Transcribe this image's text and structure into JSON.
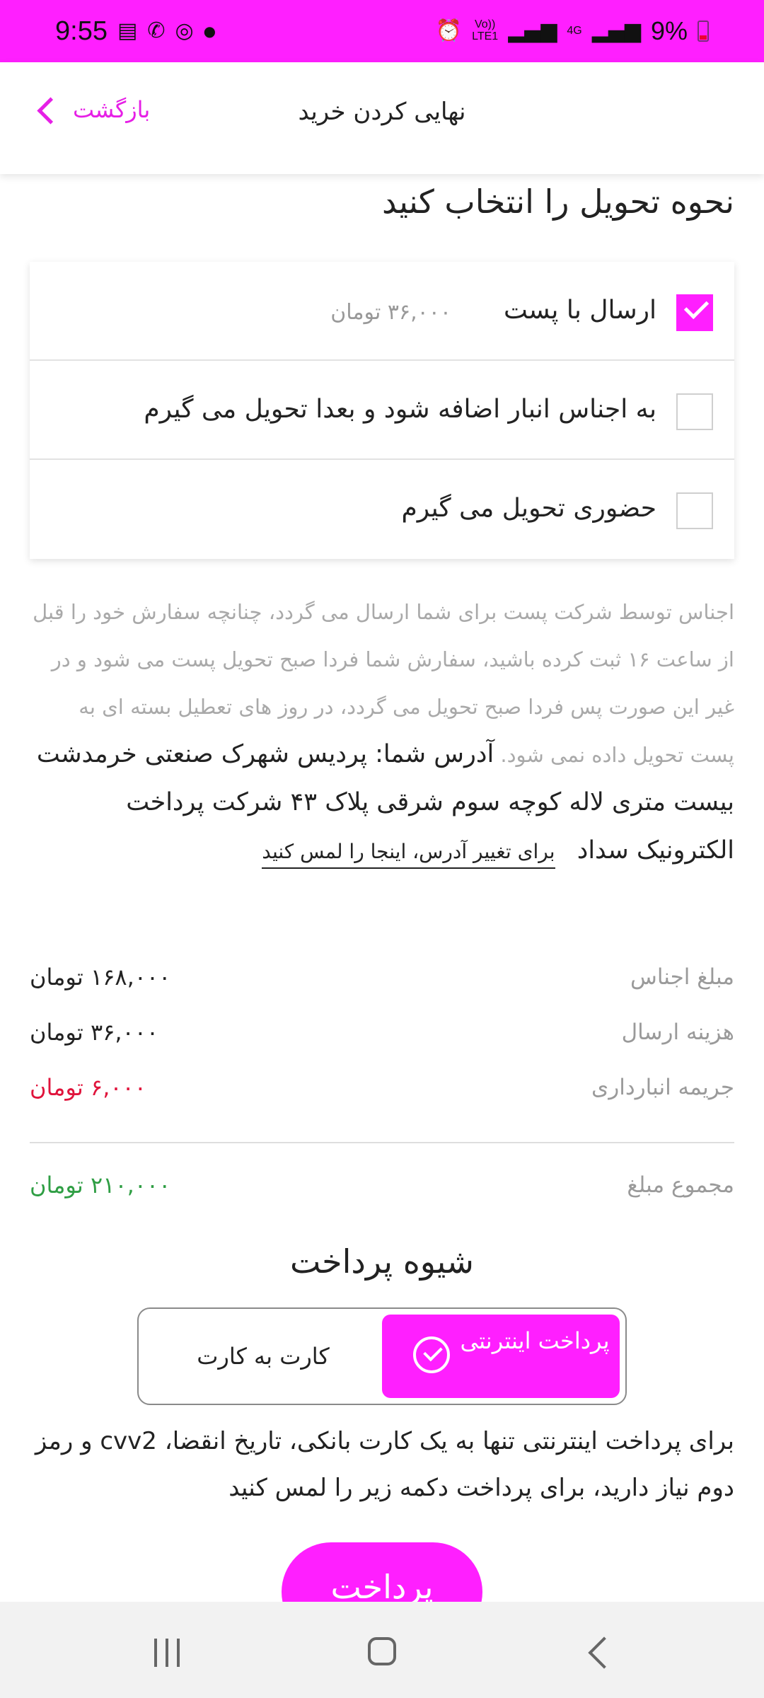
{
  "status_bar": {
    "time": "9:55",
    "battery": "9%",
    "volte": "Vo))\nLTE1",
    "network": "4G"
  },
  "header": {
    "title": "نهایی کردن خرید",
    "back_label": "بازگشت"
  },
  "delivery": {
    "title": "نحوه تحویل را انتخاب کنید",
    "options": [
      {
        "label": "ارسال با پست",
        "price": "۳۶,۰۰۰ تومان",
        "checked": true
      },
      {
        "label": "به اجناس انبار اضافه شود و بعدا تحویل می گیرم",
        "checked": false
      },
      {
        "label": "حضوری تحویل می گیرم",
        "checked": false
      }
    ]
  },
  "info": {
    "text": "اجناس توسط شرکت پست برای شما ارسال می گردد، چنانچه سفارش خود را قبل از ساعت ۱۶ ثبت کرده باشید، سفارش شما فردا صبح تحویل پست می شود و در غیر این صورت پس فردا صبح تحویل می گردد، در روز های تعطیل بسته ای به پست تحویل داده نمی شود.",
    "address": "آدرس شما: پردیس شهرک صنعتی خرمدشت بیست متری لاله کوچه سوم شرقی پلاک ۴۳ شرکت پرداخت الکترونیک سداد",
    "change_link": "برای تغییر آدرس، اینجا را لمس کنید"
  },
  "summary": {
    "items_label": "مبلغ اجناس",
    "items_value": "۱۶۸,۰۰۰ تومان",
    "shipping_label": "هزینه ارسال",
    "shipping_value": "۳۶,۰۰۰ تومان",
    "penalty_label": "جریمه انبارداری",
    "penalty_value": "۶,۰۰۰ تومان",
    "total_label": "مجموع مبلغ",
    "total_value": "۲۱۰,۰۰۰ تومان"
  },
  "payment": {
    "title": "شیوه پرداخت",
    "online_label": "پرداخت اینترنتی",
    "card_label": "کارت به کارت",
    "description": "برای پرداخت اینترنتی تنها به یک کارت بانکی، تاریخ انقضا، cvv2 و رمز دوم نیاز دارید، برای پرداخت دکمه زیر را لمس کنید",
    "button_label": "پرداخت"
  },
  "colors": {
    "accent": "#ff1fff",
    "penalty": "#e0143c",
    "total": "#2f9e44"
  }
}
